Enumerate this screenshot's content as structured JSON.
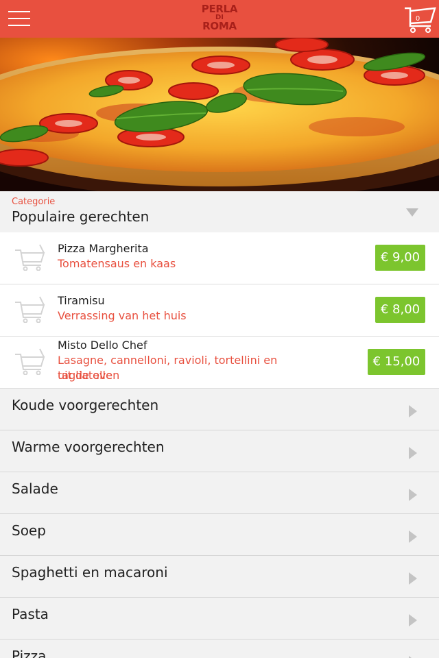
{
  "header": {
    "logo_line1": "PERLA",
    "logo_line2": "DI",
    "logo_line3": "ROMA",
    "cart_count": "0"
  },
  "category_select": {
    "label": "Categorie",
    "value": "Populaire gerechten"
  },
  "items": [
    {
      "name": "Pizza Margherita",
      "desc_line1": "Tomatensaus en kaas",
      "desc_line2": "",
      "price": "€ 9,00"
    },
    {
      "name": "Tiramisu",
      "desc_line1": "Verrassing van het huis",
      "desc_line2": "",
      "price": "€ 8,00"
    },
    {
      "name": "Misto Dello Chef",
      "desc_line1": "Lasagne, cannelloni, ravioli, tortellini en tagliatelle",
      "desc_line2": "uit de oven",
      "price": "€ 15,00"
    }
  ],
  "categories": [
    {
      "label": "Koude voorgerechten"
    },
    {
      "label": "Warme voorgerechten"
    },
    {
      "label": "Salade"
    },
    {
      "label": "Soep"
    },
    {
      "label": "Spaghetti en macaroni"
    },
    {
      "label": "Pasta"
    },
    {
      "label": "Pizza"
    }
  ],
  "colors": {
    "brand": "#e8503f",
    "price_bg": "#7cc52e"
  }
}
